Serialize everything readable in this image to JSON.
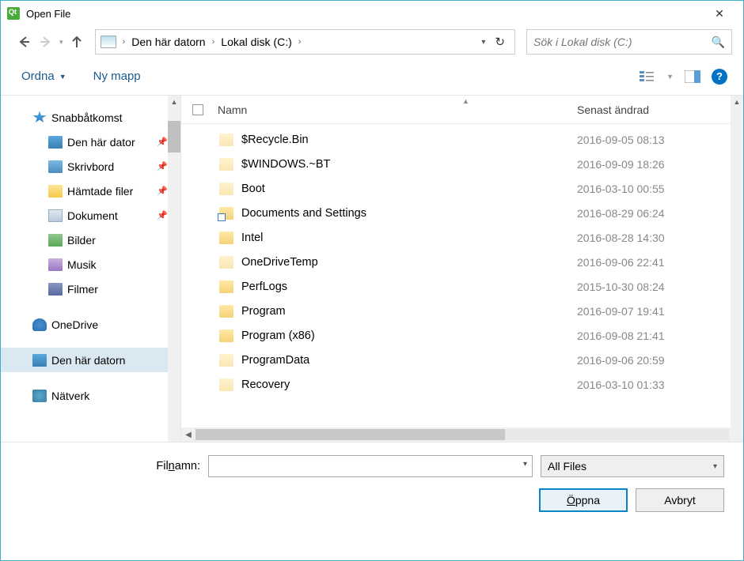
{
  "window": {
    "title": "Open File"
  },
  "breadcrumb": {
    "parts": [
      "Den här datorn",
      "Lokal disk (C:)"
    ]
  },
  "search": {
    "placeholder": "Sök i Lokal disk (C:)"
  },
  "toolbar": {
    "organize": "Ordna",
    "newfolder": "Ny mapp"
  },
  "columns": {
    "name": "Namn",
    "modified": "Senast ändrad"
  },
  "sidebar": {
    "quick": "Snabbåtkomst",
    "thispc_q": "Den här dator",
    "desktop": "Skrivbord",
    "downloads": "Hämtade filer",
    "documents": "Dokument",
    "pictures": "Bilder",
    "music": "Musik",
    "videos": "Filmer",
    "onedrive": "OneDrive",
    "thispc": "Den här datorn",
    "network": "Nätverk"
  },
  "files": [
    {
      "name": "$Recycle.Bin",
      "date": "2016-09-05 08:13",
      "faded": true
    },
    {
      "name": "$WINDOWS.~BT",
      "date": "2016-09-09 18:26",
      "faded": true
    },
    {
      "name": "Boot",
      "date": "2016-03-10 00:55",
      "faded": true
    },
    {
      "name": "Documents and Settings",
      "date": "2016-08-29 06:24",
      "link": true
    },
    {
      "name": "Intel",
      "date": "2016-08-28 14:30"
    },
    {
      "name": "OneDriveTemp",
      "date": "2016-09-06 22:41",
      "faded": true
    },
    {
      "name": "PerfLogs",
      "date": "2015-10-30 08:24"
    },
    {
      "name": "Program",
      "date": "2016-09-07 19:41"
    },
    {
      "name": "Program (x86)",
      "date": "2016-09-08 21:41"
    },
    {
      "name": "ProgramData",
      "date": "2016-09-06 20:59",
      "faded": true
    },
    {
      "name": "Recovery",
      "date": "2016-03-10 01:33",
      "faded": true
    }
  ],
  "bottom": {
    "filename_label_pre": "Fil",
    "filename_label_u": "n",
    "filename_label_post": "amn:",
    "filter": "All Files",
    "open_u": "Ö",
    "open_rest": "ppna",
    "cancel": "Avbryt"
  }
}
